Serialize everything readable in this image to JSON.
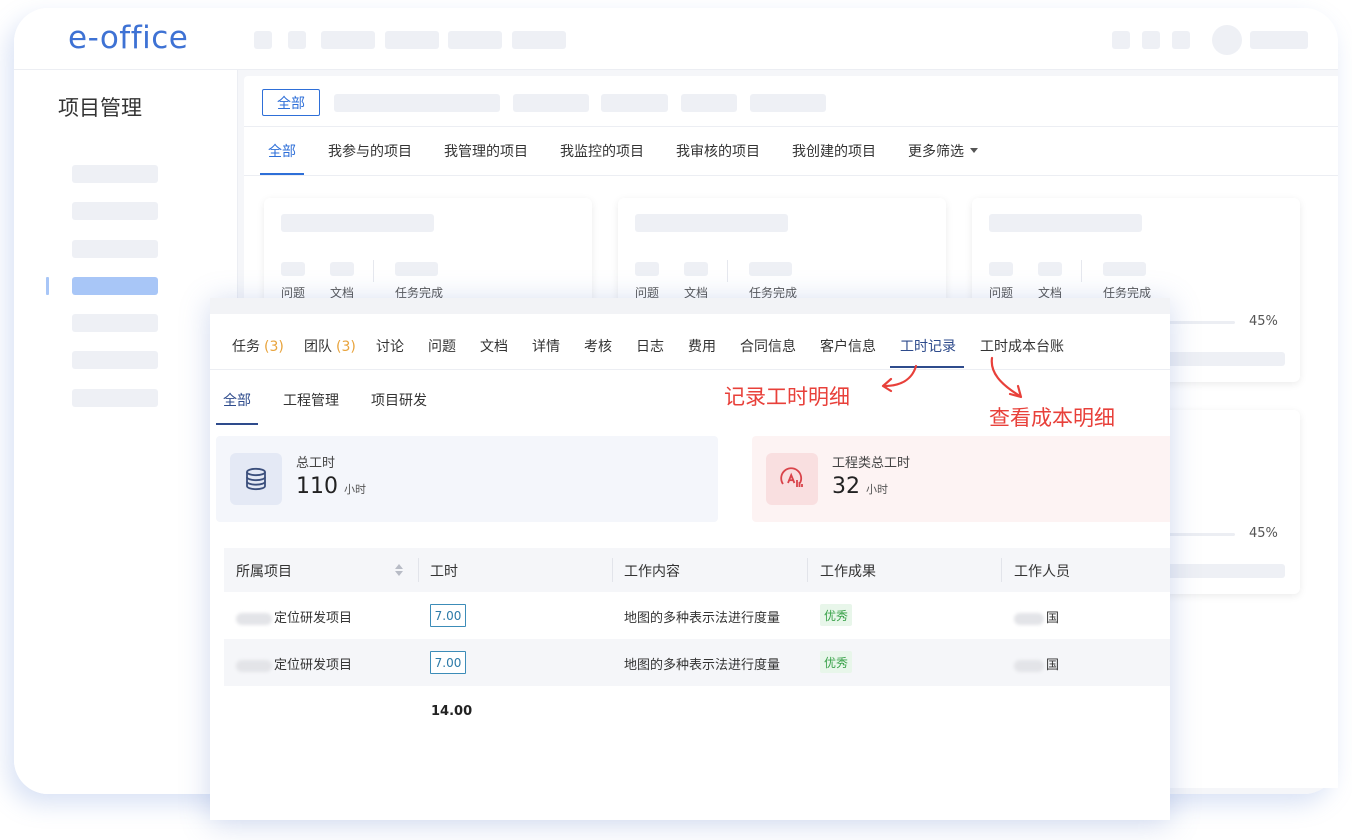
{
  "brand": {
    "logo": "e-office"
  },
  "sidebar": {
    "title": "项目管理"
  },
  "filter": {
    "chip": "全部",
    "tabs": [
      "全部",
      "我参与的项目",
      "我管理的项目",
      "我监控的项目",
      "我审核的项目",
      "我创建的项目",
      "更多筛选"
    ]
  },
  "project_cards": {
    "stat_labels": [
      "问题",
      "文档",
      "任务完成"
    ],
    "progress": [
      {
        "label": "45%",
        "fraction": 0.45
      },
      {
        "label": "45%",
        "fraction": 0.45
      }
    ]
  },
  "detail": {
    "tabs": [
      {
        "label": "任务",
        "count": "(3)"
      },
      {
        "label": "团队",
        "count": "(3)"
      },
      {
        "label": "讨论"
      },
      {
        "label": "问题"
      },
      {
        "label": "文档"
      },
      {
        "label": "详情"
      },
      {
        "label": "考核"
      },
      {
        "label": "日志"
      },
      {
        "label": "费用"
      },
      {
        "label": "合同信息"
      },
      {
        "label": "客户信息"
      },
      {
        "label": "工时记录"
      },
      {
        "label": "工时成本台账"
      }
    ],
    "subtabs": [
      "全部",
      "工程管理",
      "项目研发"
    ],
    "stats": [
      {
        "label": "总工时",
        "value": "110",
        "unit": "小时",
        "icon": "database-icon"
      },
      {
        "label": "工程类总工时",
        "value": "32",
        "unit": "小时",
        "icon": "engineering-icon"
      }
    ],
    "table": {
      "headers": [
        "所属项目",
        "工时",
        "工作内容",
        "工作成果",
        "工作人员"
      ],
      "rows": [
        {
          "project": "定位研发项目",
          "hours": "7.00",
          "content": "地图的多种表示法进行度量",
          "result": "优秀",
          "person": "国"
        },
        {
          "project": "定位研发项目",
          "hours": "7.00",
          "content": "地图的多种表示法进行度量",
          "result": "优秀",
          "person": "国"
        }
      ],
      "total": "14.00"
    }
  },
  "annotations": {
    "record": "记录工时明细",
    "cost": "查看成本明细"
  },
  "colors": {
    "accent": "#2e6fd8",
    "active_tab": "#2e4b8c",
    "annotation": "#e8403a",
    "success": "#3aa24a",
    "count": "#e8a33c"
  }
}
